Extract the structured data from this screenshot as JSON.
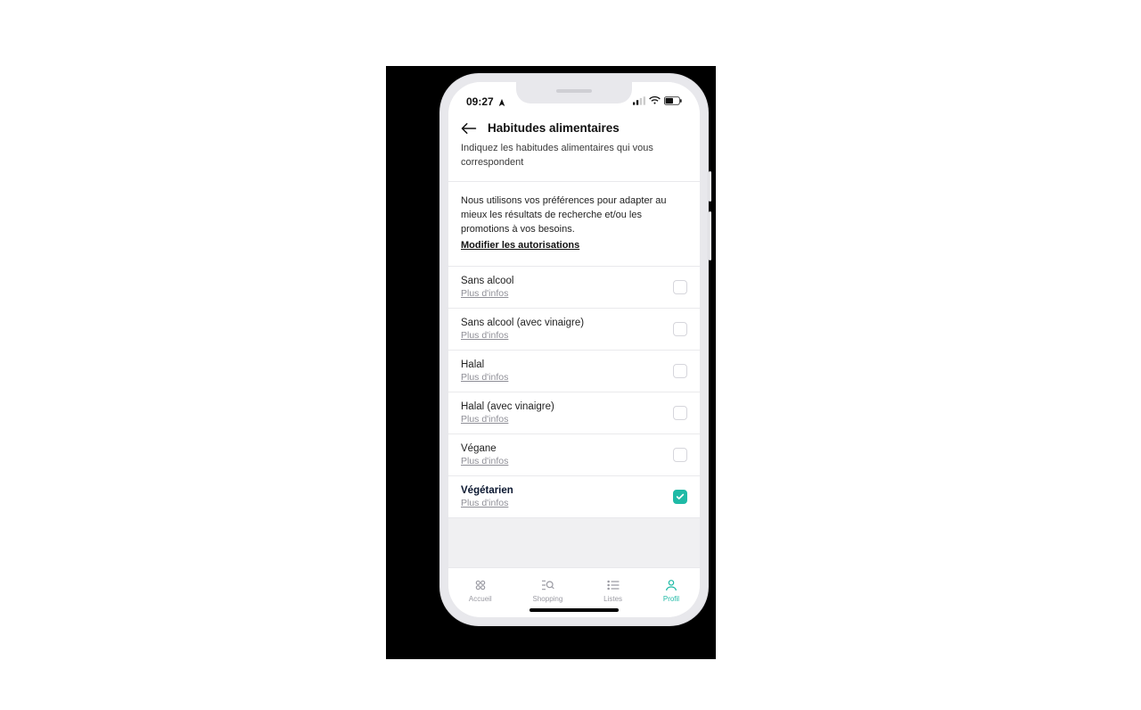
{
  "status": {
    "time": "09:27"
  },
  "header": {
    "title": "Habitudes alimentaires",
    "sub": "Indiquez les habitudes alimentaires qui vous correspondent"
  },
  "info": {
    "text": "Nous utilisons vos préférences pour adapter au mieux les résultats de recherche et/ou les promotions à vos besoins.",
    "link": "Modifier les autorisations"
  },
  "more": "Plus d'infos",
  "options": [
    {
      "label": "Sans alcool",
      "checked": false
    },
    {
      "label": "Sans alcool (avec vinaigre)",
      "checked": false
    },
    {
      "label": "Halal",
      "checked": false
    },
    {
      "label": "Halal (avec vinaigre)",
      "checked": false
    },
    {
      "label": "Végane",
      "checked": false
    },
    {
      "label": "Végétarien",
      "checked": true
    }
  ],
  "tabs": {
    "home": "Accueil",
    "shopping": "Shopping",
    "lists": "Listes",
    "profile": "Profil"
  }
}
